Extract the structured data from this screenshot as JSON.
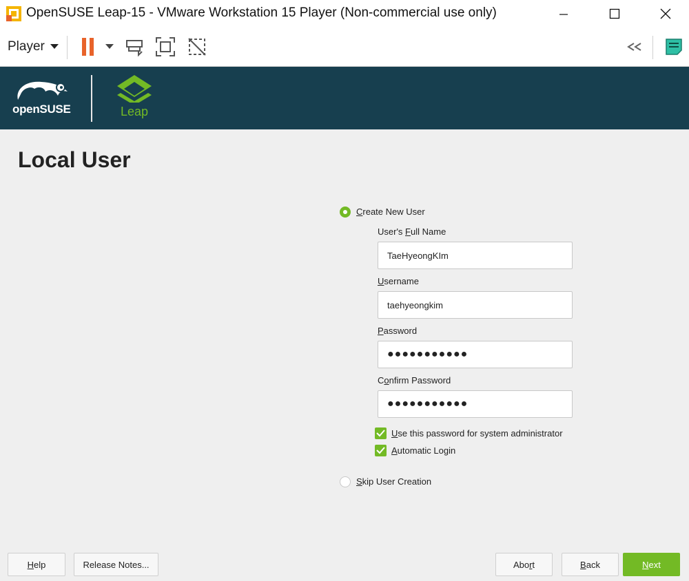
{
  "window": {
    "title": "OpenSUSE Leap-15 - VMware Workstation 15 Player (Non-commercial use only)",
    "app_icon": "vmware-icon",
    "controls": [
      "minimize-icon",
      "maximize-icon",
      "close-icon"
    ]
  },
  "toolbar": {
    "player_label": "Player",
    "icons": [
      "pause-icon",
      "dropdown-arrow-icon",
      "send-ctrl-alt-del-icon",
      "fullscreen-icon",
      "unity-icon",
      "collapse-icon",
      "message-log-icon"
    ],
    "accent": "#e8632a"
  },
  "banner": {
    "brand": "openSUSE",
    "product": "Leap",
    "background": "#173f4f",
    "accent": "#73ba25"
  },
  "page": {
    "title": "Local User"
  },
  "form": {
    "create_new_user_prefix": "",
    "create_new_user_mnemonic": "C",
    "create_new_user_rest": "reate New User",
    "create_new_user_checked": true,
    "full_name_label_a": "User's ",
    "full_name_label_m": "F",
    "full_name_label_b": "ull Name",
    "full_name_value": "TaeHyeongKIm",
    "username_label_m": "U",
    "username_label_b": "sername",
    "username_value": "taehyeongkim",
    "password_label_m": "P",
    "password_label_b": "assword",
    "password_value": "●●●●●●●●●●●",
    "confirm_label_a": "C",
    "confirm_label_m": "o",
    "confirm_label_b": "nfirm Password",
    "confirm_value": "●●●●●●●●●●●",
    "admin_pw_m": "U",
    "admin_pw_b": "se this password for system administrator",
    "admin_pw_checked": true,
    "autologin_m": "A",
    "autologin_b": "utomatic Login",
    "autologin_checked": true,
    "skip_m": "S",
    "skip_b": "kip User Creation",
    "skip_checked": false
  },
  "footer": {
    "help_m": "H",
    "help_b": "elp",
    "release_notes": "Release Notes...",
    "abort_a": "Abo",
    "abort_m": "r",
    "abort_b": "t",
    "back_m": "B",
    "back_b": "ack",
    "next_m": "N",
    "next_b": "ext"
  }
}
